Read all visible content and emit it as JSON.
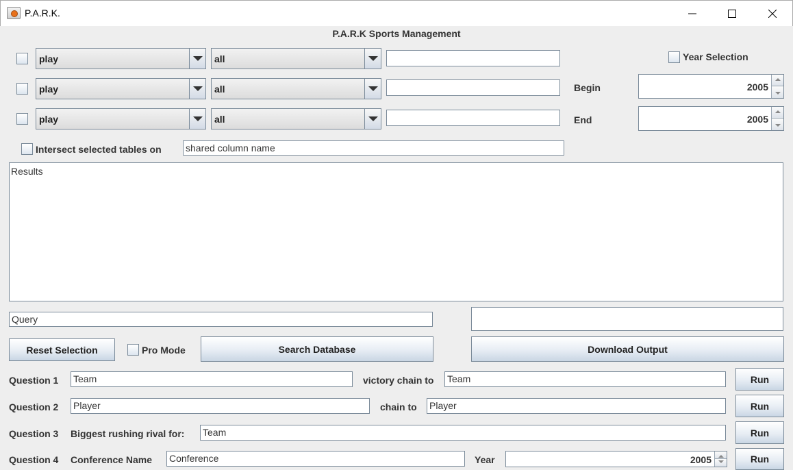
{
  "window": {
    "title": "P.A.R.K.",
    "heading": "P.A.R.K Sports Management",
    "controls": [
      "minimize-icon",
      "maximize-icon",
      "close-icon"
    ]
  },
  "filter_rows": [
    {
      "table": "play",
      "column": "all",
      "value": ""
    },
    {
      "table": "play",
      "column": "all",
      "value": ""
    },
    {
      "table": "play",
      "column": "all",
      "value": ""
    }
  ],
  "year_selection": {
    "label": "Year Selection",
    "begin_label": "Begin",
    "begin_value": "2005",
    "end_label": "End",
    "end_value": "2005"
  },
  "intersect": {
    "label": "Intersect selected tables on",
    "field_value": "shared column name"
  },
  "results": {
    "text": "Results"
  },
  "query": {
    "value": "Query",
    "output_value": ""
  },
  "actions": {
    "reset": "Reset Selection",
    "pro_mode": "Pro Mode",
    "search": "Search Database",
    "download": "Download Output"
  },
  "questions": {
    "q1": {
      "label": "Question 1",
      "field1": "Team",
      "connector": "victory chain to",
      "field2": "Team",
      "run": "Run"
    },
    "q2": {
      "label": "Question 2",
      "field1": "Player",
      "connector": "chain to",
      "field2": "Player",
      "run": "Run"
    },
    "q3": {
      "label": "Question 3",
      "connector": "Biggest rushing rival for:",
      "field1": "Team",
      "run": "Run"
    },
    "q4": {
      "label": "Question 4",
      "connector": "Conference Name",
      "field1": "Conference",
      "year_label": "Year",
      "year_value": "2005",
      "run": "Run"
    }
  }
}
